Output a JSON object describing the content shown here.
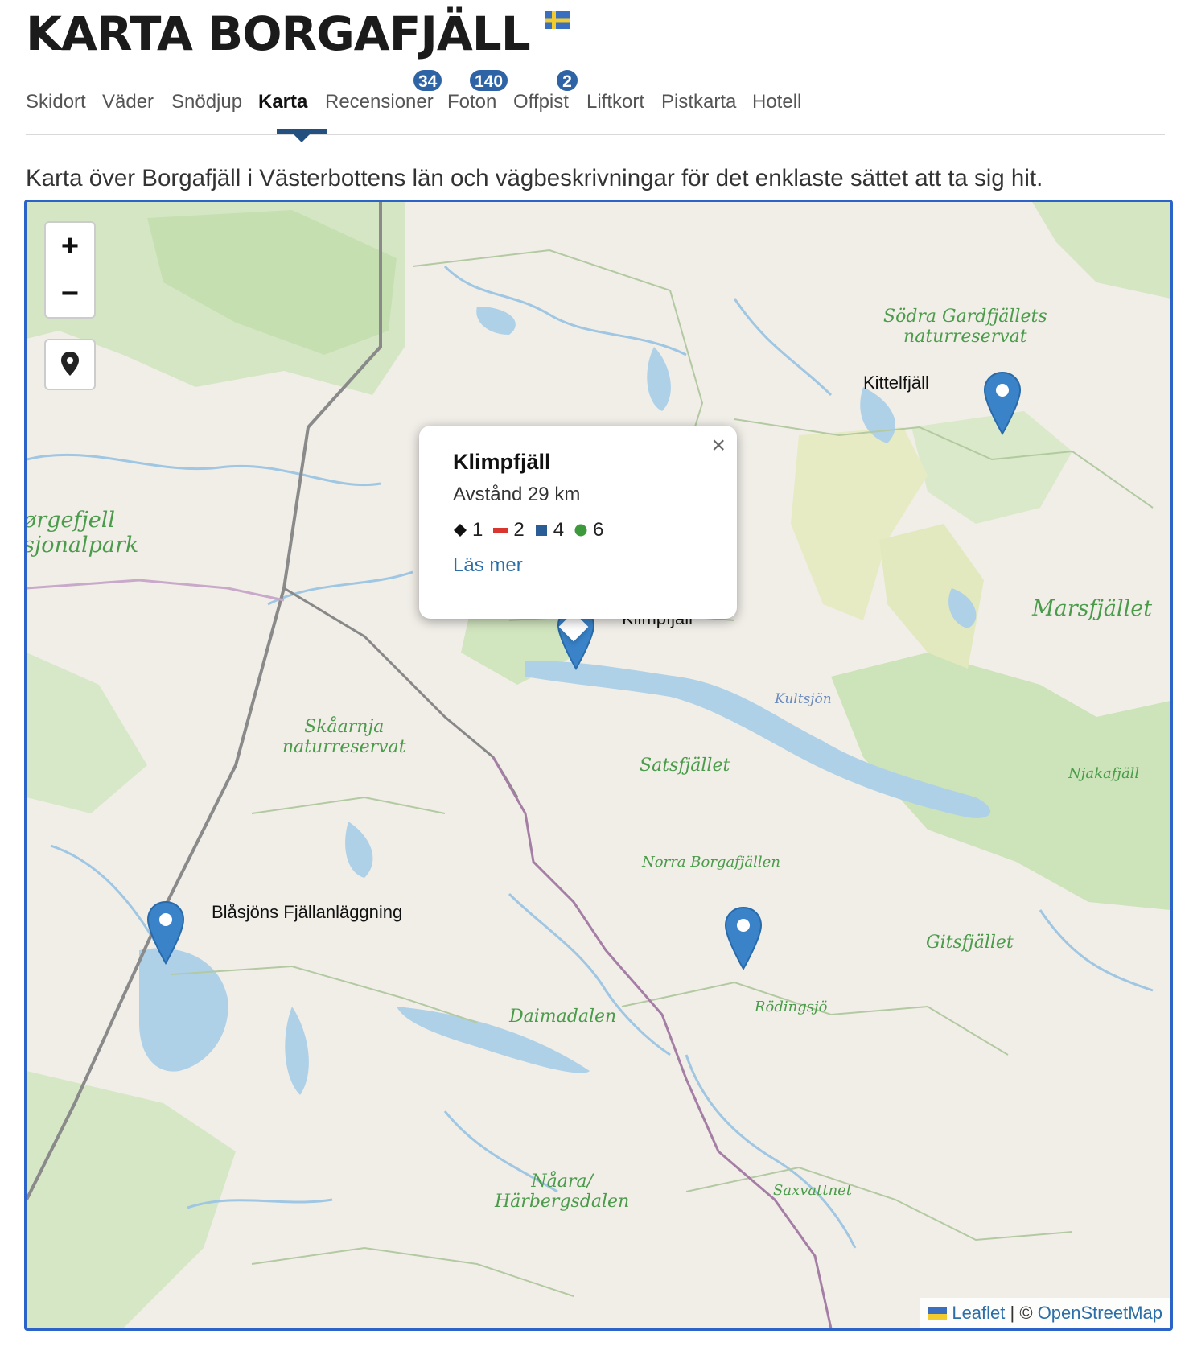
{
  "header": {
    "title": "KARTA BORGAFJÄLL"
  },
  "tabs": [
    {
      "label": "Skidort"
    },
    {
      "label": "Väder"
    },
    {
      "label": "Snödjup"
    },
    {
      "label": "Karta",
      "active": true
    },
    {
      "label": "Recensioner",
      "badge": "34"
    },
    {
      "label": "Foton",
      "badge": "140"
    },
    {
      "label": "Offpist",
      "badge": "2"
    },
    {
      "label": "Liftkort"
    },
    {
      "label": "Pistkarta"
    },
    {
      "label": "Hotell"
    }
  ],
  "intro": "Karta över Borgafjäll i Västerbottens län och vägbeskrivningar för det enklaste sättet att ta sig hit.",
  "map": {
    "zoom_in": "+",
    "zoom_out": "−",
    "place_labels": [
      {
        "text": "Södra Gardfjällets",
        "line2": "naturreservat"
      },
      {
        "text": "Marsfjället"
      },
      {
        "text": "ørgefjell",
        "line2": "sjonalpark"
      },
      {
        "text": "Skåarnja",
        "line2": "naturreservat"
      },
      {
        "text": "Satsfjället"
      },
      {
        "text": "Kultsjön"
      },
      {
        "text": "Njakafjäll"
      },
      {
        "text": "Norra Borgafjällen"
      },
      {
        "text": "Gitsfjället"
      },
      {
        "text": "Rödingsjö"
      },
      {
        "text": "Daimadalen"
      },
      {
        "text": "Nåara/",
        "line2": "Härbergsdalen"
      },
      {
        "text": "Saxvattnet"
      }
    ],
    "markers": [
      {
        "label": "Kittelfjäll"
      },
      {
        "label": "Klimpfjäll"
      },
      {
        "label": "Blåsjöns Fjällanläggning"
      },
      {
        "label": ""
      }
    ],
    "popup": {
      "title": "Klimpfjäll",
      "distance": "Avstånd 29 km",
      "runs": {
        "black": "1",
        "red": "2",
        "blue": "4",
        "green": "6"
      },
      "link": "Läs mer",
      "close": "×"
    },
    "attribution": {
      "leaflet": "Leaflet",
      "separator": "| ©",
      "osm": "OpenStreetMap"
    }
  }
}
